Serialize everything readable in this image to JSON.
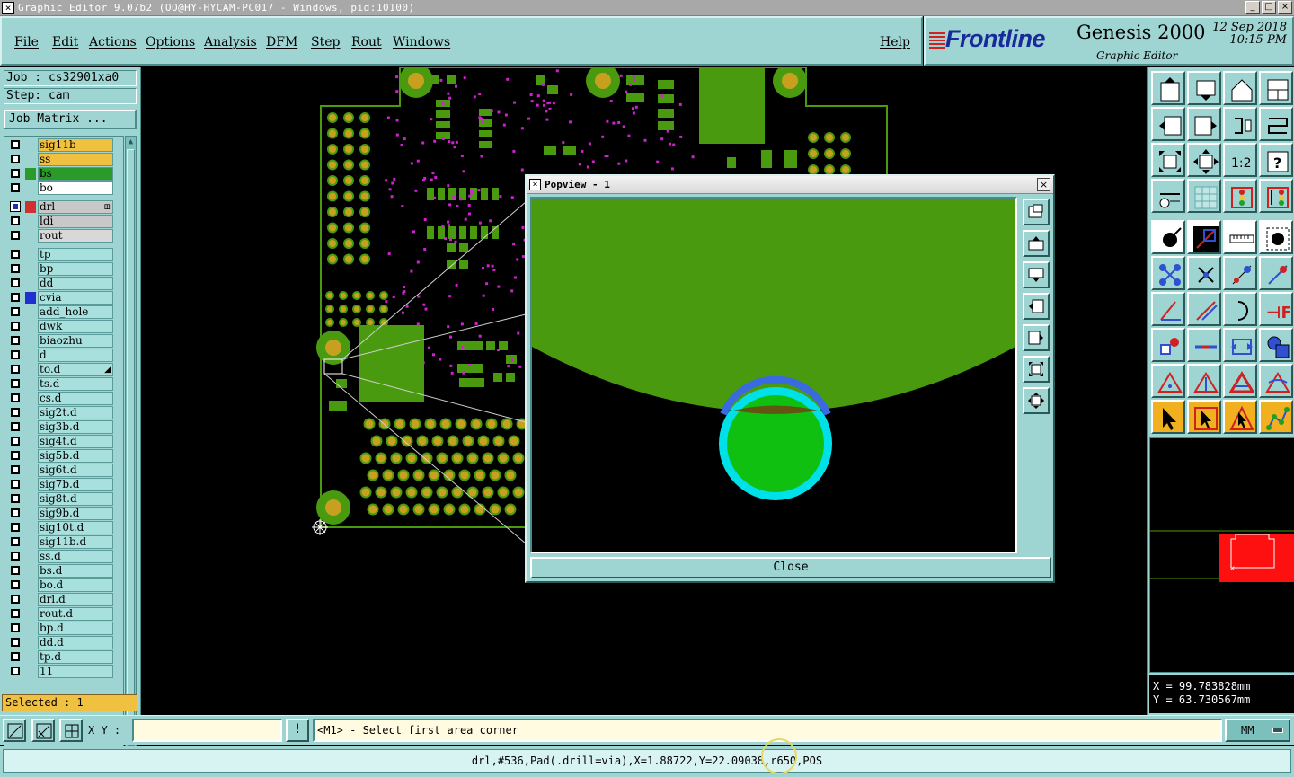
{
  "window": {
    "title": "Graphic Editor 9.07b2 (OO@HY-HYCAM-PC017 - Windows, pid:10100)",
    "controls": [
      "_",
      "□",
      "×"
    ]
  },
  "menu": {
    "items": [
      "File",
      "Edit",
      "Actions",
      "Options",
      "Analysis",
      "DFM",
      "Step",
      "Rout",
      "Windows"
    ],
    "help": "Help"
  },
  "brand": {
    "logo": "Frontline",
    "product": "Genesis 2000",
    "subtitle": "Graphic Editor",
    "date": "12 Sep 2018",
    "time": "10:15 PM"
  },
  "job": {
    "job_label": "Job : cs32901xa0",
    "step_label": "Step: cam",
    "matrix_button": "Job Matrix ..."
  },
  "layers": [
    {
      "name": "sig11b",
      "color": "orange",
      "checked": false
    },
    {
      "name": "ss",
      "color": "orange",
      "checked": false
    },
    {
      "name": "bs",
      "color": "green",
      "checked": false,
      "swatch": "#2a9a2a"
    },
    {
      "name": "bo",
      "color": "white",
      "checked": false
    },
    {
      "name": "drl",
      "color": "gray",
      "checked": true,
      "swatch": "#d03030",
      "mark": "⊞"
    },
    {
      "name": "ldi",
      "color": "gray",
      "checked": false
    },
    {
      "name": "rout",
      "color": "lgray",
      "checked": false
    },
    {
      "name": "tp",
      "color": "",
      "checked": false
    },
    {
      "name": "bp",
      "color": "",
      "checked": false
    },
    {
      "name": "dd",
      "color": "",
      "checked": false
    },
    {
      "name": "cvia",
      "color": "",
      "checked": false,
      "swatch": "#1e30d0"
    },
    {
      "name": "add_hole",
      "color": "",
      "checked": false
    },
    {
      "name": "dwk",
      "color": "",
      "checked": false
    },
    {
      "name": "biaozhu",
      "color": "",
      "checked": false
    },
    {
      "name": "d",
      "color": "",
      "checked": false
    },
    {
      "name": "to.d",
      "color": "",
      "checked": false,
      "mark": "◢"
    },
    {
      "name": "ts.d",
      "color": "",
      "checked": false
    },
    {
      "name": "cs.d",
      "color": "",
      "checked": false
    },
    {
      "name": "sig2t.d",
      "color": "",
      "checked": false
    },
    {
      "name": "sig3b.d",
      "color": "",
      "checked": false
    },
    {
      "name": "sig4t.d",
      "color": "",
      "checked": false
    },
    {
      "name": "sig5b.d",
      "color": "",
      "checked": false
    },
    {
      "name": "sig6t.d",
      "color": "",
      "checked": false
    },
    {
      "name": "sig7b.d",
      "color": "",
      "checked": false
    },
    {
      "name": "sig8t.d",
      "color": "",
      "checked": false
    },
    {
      "name": "sig9b.d",
      "color": "",
      "checked": false
    },
    {
      "name": "sig10t.d",
      "color": "",
      "checked": false
    },
    {
      "name": "sig11b.d",
      "color": "",
      "checked": false
    },
    {
      "name": "ss.d",
      "color": "",
      "checked": false
    },
    {
      "name": "bs.d",
      "color": "",
      "checked": false
    },
    {
      "name": "bo.d",
      "color": "",
      "checked": false
    },
    {
      "name": "drl.d",
      "color": "",
      "checked": false
    },
    {
      "name": "rout.d",
      "color": "",
      "checked": false
    },
    {
      "name": "bp.d",
      "color": "",
      "checked": false
    },
    {
      "name": "dd.d",
      "color": "",
      "checked": false
    },
    {
      "name": "tp.d",
      "color": "",
      "checked": false
    },
    {
      "name": "11",
      "color": "",
      "checked": false
    }
  ],
  "selected": "Selected : 1",
  "popview": {
    "title": "Popview - 1",
    "close_label": "Close",
    "close_x": "×"
  },
  "toolbar_icons": [
    "open-job-icon",
    "save-icon",
    "home-icon",
    "window-split-icon",
    "step-left-icon",
    "step-right-icon",
    "rotate-icon",
    "snake-icon",
    "zoom-fit-icon",
    "zoom-center-icon",
    "zoom-1to1-icon",
    "help-icon",
    "ruler-settings-icon",
    "grid-icon",
    "layer-color-icon",
    "layer-select-icon",
    "add-pad-icon",
    "measure-icon",
    "ruler-icon",
    "feature-icon",
    "connect-icon",
    "cross-icon",
    "move-icon",
    "edit-node-icon",
    "angle-icon",
    "line-icon",
    "arc-icon",
    "text-icon",
    "pad-edit-icon",
    "line-edit-icon",
    "resize-icon",
    "group-icon",
    "tri-a-icon",
    "tri-b-icon",
    "tri-c-icon",
    "tri-d-icon",
    "pointer-icon",
    "select-icon",
    "select-b-icon",
    "net-icon"
  ],
  "zoom_labels": {
    "one_to_one": "1:2",
    "help": "?"
  },
  "coords": {
    "x": "X = 99.783828mm",
    "y": "Y = 63.730567mm"
  },
  "bottom": {
    "xy_label": "X Y :",
    "xy_value": "",
    "msg_icon": "!",
    "message": "<M1> - Select first area corner",
    "units": "MM"
  },
  "status": "drl,#536,Pad(.drill=via),X=1.88722,Y=22.09038,r650,POS",
  "colors": {
    "panel": "#9ed5d3",
    "copper": "#4a9a10",
    "pad": "#c8a020",
    "drill": "#00e0e8",
    "via": "#d020d0"
  }
}
